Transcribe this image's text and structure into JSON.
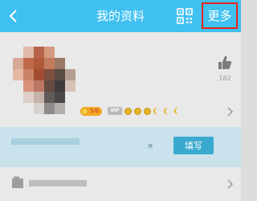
{
  "nav": {
    "back_icon": "chevron-left-icon",
    "title": "我的资料",
    "qr_icon": "qr-code-icon",
    "more_label": "更多",
    "colors": {
      "bar": "#3fc0f0",
      "highlight": "#e8231d"
    }
  },
  "profile": {
    "avatar_pixelated": true,
    "likes": {
      "icon": "thumbs-up-icon",
      "count": "182"
    },
    "level_badge": "5/8",
    "vip_label": "VIP",
    "grade_icons": [
      "sun",
      "sun",
      "sun",
      "moon",
      "moon",
      "moon"
    ]
  },
  "banner": {
    "text_redacted": true,
    "close_icon": "close-icon",
    "button_label": "填写"
  },
  "list_row": {
    "icon": "folder-icon",
    "text_redacted": true
  }
}
